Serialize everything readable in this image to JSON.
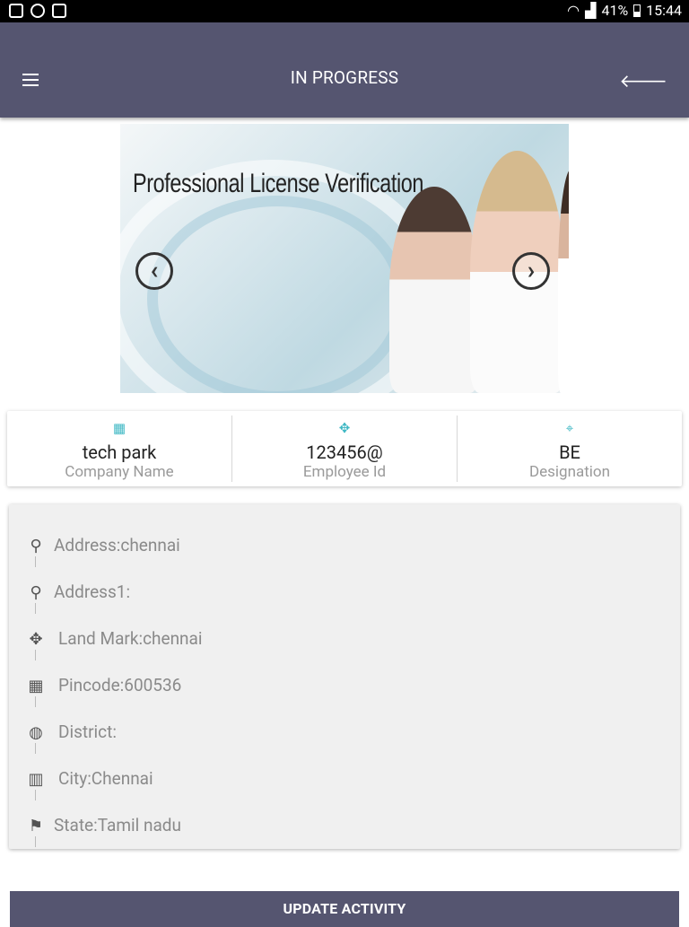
{
  "status_bar": {
    "battery": "41%",
    "time": "15:44",
    "battery_level": 0.41
  },
  "app_bar": {
    "title": "IN PROGRESS",
    "menu_icon": "hamburger-icon",
    "back_icon": "arrow-back-icon"
  },
  "carousel": {
    "slide_title": "Professional License Verification",
    "prev_glyph": "‹",
    "next_glyph": "›"
  },
  "info": [
    {
      "value": "tech park",
      "label": "Company Name",
      "icon": "building-icon"
    },
    {
      "value": "123456@",
      "label": "Employee Id",
      "icon": "map-pin-icon"
    },
    {
      "value": "BE",
      "label": "Designation",
      "icon": "location-icon"
    }
  ],
  "address": [
    {
      "text": "Address:chennai",
      "icon": "location-pin-icon"
    },
    {
      "text": "Address1:",
      "icon": "location-pin-icon"
    },
    {
      "text": "Land Mark:chennai",
      "icon": "landmark-icon"
    },
    {
      "text": "Pincode:600536",
      "icon": "keypad-icon"
    },
    {
      "text": "District:",
      "icon": "globe-icon"
    },
    {
      "text": "City:Chennai",
      "icon": "city-icon"
    },
    {
      "text": "State:Tamil nadu",
      "icon": "state-map-icon"
    }
  ],
  "actions": {
    "update_label": "UPDATE ACTIVITY"
  },
  "colors": {
    "primary": "#555570",
    "accent": "#3fb8c4"
  }
}
